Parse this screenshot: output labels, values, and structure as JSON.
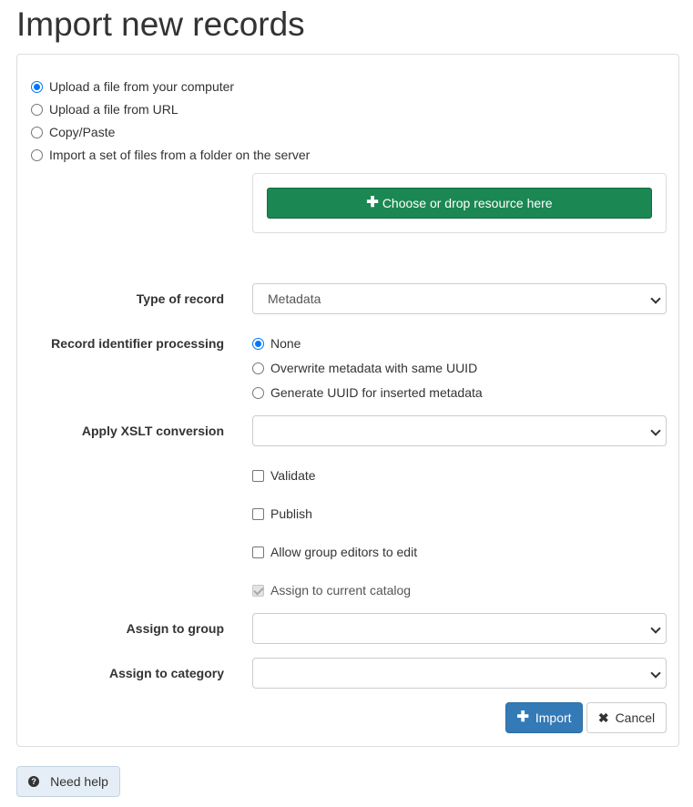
{
  "page": {
    "title": "Import new records"
  },
  "source": {
    "options": [
      {
        "label": "Upload a file from your computer",
        "checked": true
      },
      {
        "label": "Upload a file from URL",
        "checked": false
      },
      {
        "label": "Copy/Paste",
        "checked": false
      },
      {
        "label": "Import a set of files from a folder on the server",
        "checked": false
      }
    ],
    "choose_label": "Choose or drop resource here"
  },
  "form": {
    "type_of_record": {
      "label": "Type of record",
      "value": "Metadata"
    },
    "identifier": {
      "label": "Record identifier processing",
      "options": [
        {
          "label": "None",
          "checked": true
        },
        {
          "label": "Overwrite metadata with same UUID",
          "checked": false
        },
        {
          "label": "Generate UUID for inserted metadata",
          "checked": false
        }
      ]
    },
    "xslt": {
      "label": "Apply XSLT conversion",
      "value": ""
    },
    "checkboxes": [
      {
        "label": "Validate",
        "checked": false,
        "disabled": false
      },
      {
        "label": "Publish",
        "checked": false,
        "disabled": false
      },
      {
        "label": "Allow group editors to edit",
        "checked": false,
        "disabled": false
      },
      {
        "label": "Assign to current catalog",
        "checked": true,
        "disabled": true
      }
    ],
    "group": {
      "label": "Assign to group",
      "value": ""
    },
    "category": {
      "label": "Assign to category",
      "value": ""
    }
  },
  "actions": {
    "import_label": "Import",
    "cancel_label": "Cancel",
    "help_label": "Need help"
  },
  "colors": {
    "primary": "#337ab7",
    "success": "#1b8753",
    "radio_accent": "#0075ff"
  },
  "icons": {
    "choose": "plus-icon",
    "import": "plus-icon",
    "cancel": "close-icon",
    "help": "question-circle-icon",
    "select": "chevron-down-icon"
  }
}
